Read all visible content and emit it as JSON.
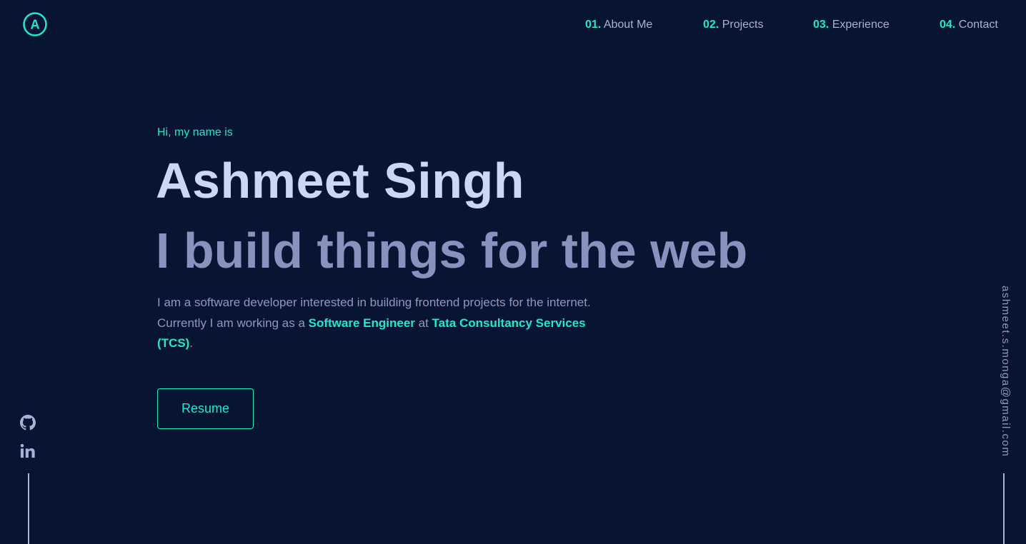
{
  "logo": {
    "letter": "A"
  },
  "nav": {
    "items": [
      {
        "num": "01.",
        "label": "About Me"
      },
      {
        "num": "02.",
        "label": "Projects"
      },
      {
        "num": "03.",
        "label": "Experience"
      },
      {
        "num": "04.",
        "label": "Contact"
      }
    ]
  },
  "hero": {
    "intro": "Hi, my name is",
    "name": "Ashmeet Singh",
    "tagline": "I build things for the web",
    "desc_part1": "I am a software developer interested in building frontend projects for the internet. Currently I am working as a ",
    "role": "Software Engineer",
    "desc_part2": " at ",
    "company": "Tata Consultancy Services (TCS)",
    "desc_part3": ".",
    "resume_label": "Resume"
  },
  "social": {
    "icons": [
      "github-icon",
      "linkedin-icon"
    ]
  },
  "email": "ashmeet.s.monga@gmail.com",
  "colors": {
    "background": "#071432",
    "accent": "#1de9d2",
    "heading": "#ccd6f6",
    "muted": "#8892bf"
  }
}
